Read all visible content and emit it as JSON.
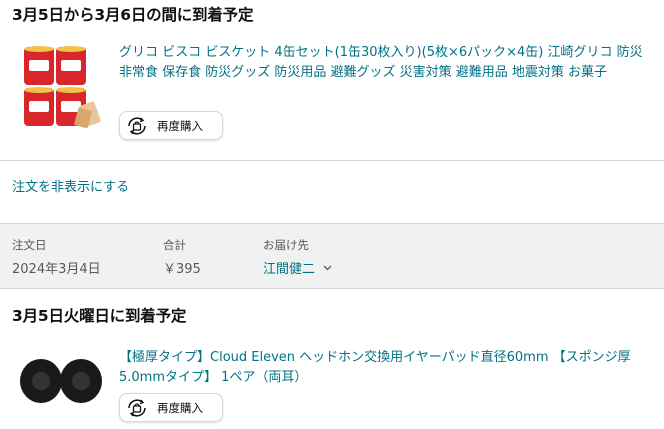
{
  "order1": {
    "delivery_title": "3月5日から3月6日の間に到着予定",
    "product_title": "グリコ ビスコ ビスケット 4缶セット(1缶30枚入り)(5枚×6パック×4缶) 江崎グリコ 防災 非常食 保存食 防災グッズ 防災用品 避難グッズ 災害対策 避難用品 地震対策 お菓子",
    "rebuy_label": "再度購入",
    "hide_order_label": "注文を非表示にする"
  },
  "order2": {
    "summary": {
      "date_label": "注文日",
      "date_value": "2024年3月4日",
      "total_label": "合計",
      "total_value": "￥395",
      "ship_label": "お届け先",
      "ship_value": "江間健二"
    },
    "delivery_title": "3月5日火曜日に到着予定",
    "product_title": "【極厚タイプ】Cloud Eleven ヘッドホン交換用イヤーパッド直径60mm 【スポンジ厚5.0mmタイプ】 1ペア（両耳）",
    "rebuy_label": "再度購入"
  },
  "colors": {
    "link": "#007185",
    "divider": "#d5d9d9",
    "summary_bg": "#f0f2f2",
    "text": "#0f1111",
    "muted": "#565959"
  },
  "icons": [
    "rebuy-icon",
    "chevron-down-icon"
  ]
}
